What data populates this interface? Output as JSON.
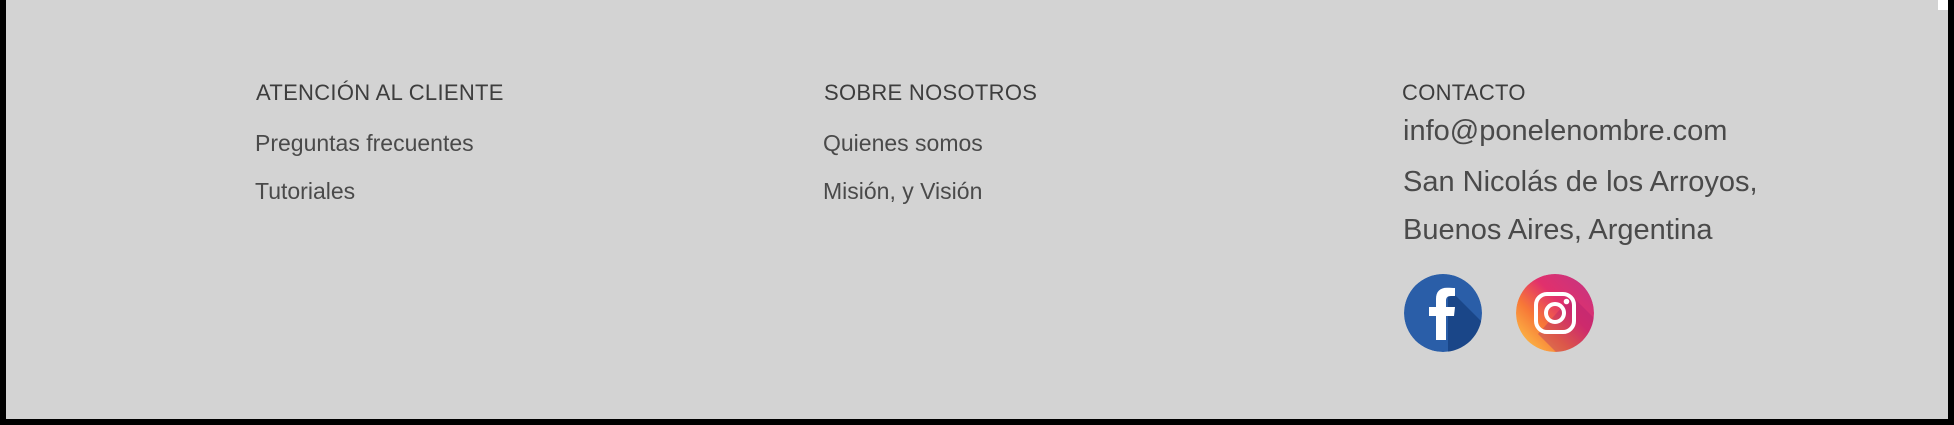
{
  "footer": {
    "customer_service": {
      "heading": "ATENCIÓN AL CLIENTE",
      "links": [
        "Preguntas frecuentes",
        "Tutoriales"
      ]
    },
    "about": {
      "heading": "SOBRE NOSOTROS",
      "links": [
        "Quienes somos",
        "Misión, y Visión"
      ]
    },
    "contact": {
      "heading": "CONTACTO",
      "email": "info@ponelenombre.com",
      "address_line1": "San Nicolás de los Arroyos,",
      "address_line2": "Buenos Aires, Argentina",
      "social": [
        {
          "icon": "facebook-icon",
          "color": "#2a5ea8"
        },
        {
          "icon": "instagram-icon",
          "color": "#e1306c"
        }
      ]
    },
    "colors": {
      "background": "#d3d3d3",
      "text": "#4a4a4a",
      "frame": "#000000"
    }
  }
}
